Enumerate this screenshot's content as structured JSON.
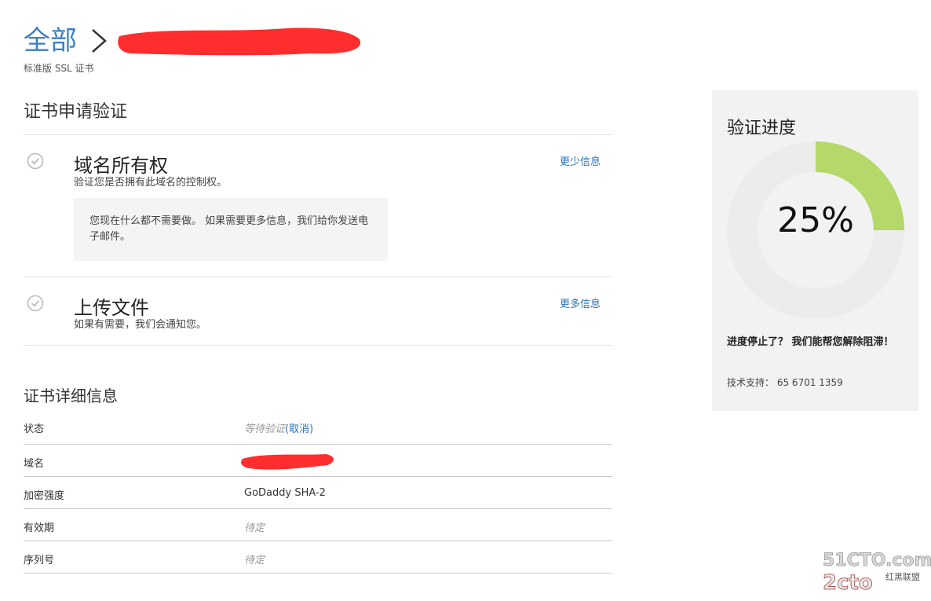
{
  "breadcrumb": {
    "root": "全部",
    "subtitle": "标准版 SSL 证书"
  },
  "verification": {
    "title": "证书申请验证",
    "steps": [
      {
        "title": "域名所有权",
        "desc": "验证您是否拥有此域名的控制权。",
        "link": "更少信息",
        "note": "您现在什么都不需要做。 如果需要更多信息，我们给你发送电子邮件。"
      },
      {
        "title": "上传文件",
        "desc": "如果有需要，我们会通知您。",
        "link": "更多信息"
      }
    ]
  },
  "details": {
    "title": "证书详细信息",
    "rows": [
      {
        "label": "状态",
        "value": "等待验证",
        "action": "(取消)"
      },
      {
        "label": "域名",
        "value": ""
      },
      {
        "label": "加密强度",
        "value": "GoDaddy SHA-2"
      },
      {
        "label": "有效期",
        "value": "待定"
      },
      {
        "label": "序列号",
        "value": "待定"
      }
    ]
  },
  "progress": {
    "title": "验证进度",
    "percent_label": "25%",
    "percent": 25,
    "stalled_text": "进度停止了？ 我们能帮您解除阻滞！",
    "support_label": "技术支持：",
    "support_phone": "65 6701 1359",
    "colors": {
      "fill": "#b5d86a",
      "track": "#ececec",
      "center": "#f2f2f2"
    }
  },
  "watermark": {
    "line1": "51CTO.com",
    "line2": "2cto",
    "line3": "红黑联盟"
  }
}
